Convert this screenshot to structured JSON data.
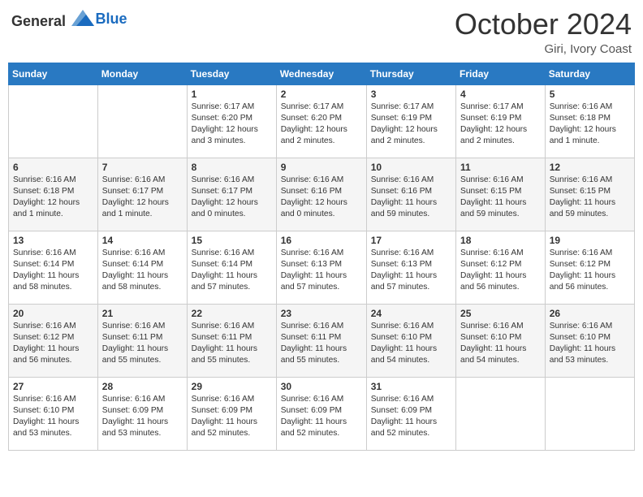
{
  "header": {
    "logo_general": "General",
    "logo_blue": "Blue",
    "month": "October 2024",
    "location": "Giri, Ivory Coast"
  },
  "weekdays": [
    "Sunday",
    "Monday",
    "Tuesday",
    "Wednesday",
    "Thursday",
    "Friday",
    "Saturday"
  ],
  "weeks": [
    [
      null,
      null,
      {
        "day": "1",
        "sunrise": "Sunrise: 6:17 AM",
        "sunset": "Sunset: 6:20 PM",
        "daylight": "Daylight: 12 hours and 3 minutes."
      },
      {
        "day": "2",
        "sunrise": "Sunrise: 6:17 AM",
        "sunset": "Sunset: 6:20 PM",
        "daylight": "Daylight: 12 hours and 2 minutes."
      },
      {
        "day": "3",
        "sunrise": "Sunrise: 6:17 AM",
        "sunset": "Sunset: 6:19 PM",
        "daylight": "Daylight: 12 hours and 2 minutes."
      },
      {
        "day": "4",
        "sunrise": "Sunrise: 6:17 AM",
        "sunset": "Sunset: 6:19 PM",
        "daylight": "Daylight: 12 hours and 2 minutes."
      },
      {
        "day": "5",
        "sunrise": "Sunrise: 6:16 AM",
        "sunset": "Sunset: 6:18 PM",
        "daylight": "Daylight: 12 hours and 1 minute."
      }
    ],
    [
      {
        "day": "6",
        "sunrise": "Sunrise: 6:16 AM",
        "sunset": "Sunset: 6:18 PM",
        "daylight": "Daylight: 12 hours and 1 minute."
      },
      {
        "day": "7",
        "sunrise": "Sunrise: 6:16 AM",
        "sunset": "Sunset: 6:17 PM",
        "daylight": "Daylight: 12 hours and 1 minute."
      },
      {
        "day": "8",
        "sunrise": "Sunrise: 6:16 AM",
        "sunset": "Sunset: 6:17 PM",
        "daylight": "Daylight: 12 hours and 0 minutes."
      },
      {
        "day": "9",
        "sunrise": "Sunrise: 6:16 AM",
        "sunset": "Sunset: 6:16 PM",
        "daylight": "Daylight: 12 hours and 0 minutes."
      },
      {
        "day": "10",
        "sunrise": "Sunrise: 6:16 AM",
        "sunset": "Sunset: 6:16 PM",
        "daylight": "Daylight: 11 hours and 59 minutes."
      },
      {
        "day": "11",
        "sunrise": "Sunrise: 6:16 AM",
        "sunset": "Sunset: 6:15 PM",
        "daylight": "Daylight: 11 hours and 59 minutes."
      },
      {
        "day": "12",
        "sunrise": "Sunrise: 6:16 AM",
        "sunset": "Sunset: 6:15 PM",
        "daylight": "Daylight: 11 hours and 59 minutes."
      }
    ],
    [
      {
        "day": "13",
        "sunrise": "Sunrise: 6:16 AM",
        "sunset": "Sunset: 6:14 PM",
        "daylight": "Daylight: 11 hours and 58 minutes."
      },
      {
        "day": "14",
        "sunrise": "Sunrise: 6:16 AM",
        "sunset": "Sunset: 6:14 PM",
        "daylight": "Daylight: 11 hours and 58 minutes."
      },
      {
        "day": "15",
        "sunrise": "Sunrise: 6:16 AM",
        "sunset": "Sunset: 6:14 PM",
        "daylight": "Daylight: 11 hours and 57 minutes."
      },
      {
        "day": "16",
        "sunrise": "Sunrise: 6:16 AM",
        "sunset": "Sunset: 6:13 PM",
        "daylight": "Daylight: 11 hours and 57 minutes."
      },
      {
        "day": "17",
        "sunrise": "Sunrise: 6:16 AM",
        "sunset": "Sunset: 6:13 PM",
        "daylight": "Daylight: 11 hours and 57 minutes."
      },
      {
        "day": "18",
        "sunrise": "Sunrise: 6:16 AM",
        "sunset": "Sunset: 6:12 PM",
        "daylight": "Daylight: 11 hours and 56 minutes."
      },
      {
        "day": "19",
        "sunrise": "Sunrise: 6:16 AM",
        "sunset": "Sunset: 6:12 PM",
        "daylight": "Daylight: 11 hours and 56 minutes."
      }
    ],
    [
      {
        "day": "20",
        "sunrise": "Sunrise: 6:16 AM",
        "sunset": "Sunset: 6:12 PM",
        "daylight": "Daylight: 11 hours and 56 minutes."
      },
      {
        "day": "21",
        "sunrise": "Sunrise: 6:16 AM",
        "sunset": "Sunset: 6:11 PM",
        "daylight": "Daylight: 11 hours and 55 minutes."
      },
      {
        "day": "22",
        "sunrise": "Sunrise: 6:16 AM",
        "sunset": "Sunset: 6:11 PM",
        "daylight": "Daylight: 11 hours and 55 minutes."
      },
      {
        "day": "23",
        "sunrise": "Sunrise: 6:16 AM",
        "sunset": "Sunset: 6:11 PM",
        "daylight": "Daylight: 11 hours and 55 minutes."
      },
      {
        "day": "24",
        "sunrise": "Sunrise: 6:16 AM",
        "sunset": "Sunset: 6:10 PM",
        "daylight": "Daylight: 11 hours and 54 minutes."
      },
      {
        "day": "25",
        "sunrise": "Sunrise: 6:16 AM",
        "sunset": "Sunset: 6:10 PM",
        "daylight": "Daylight: 11 hours and 54 minutes."
      },
      {
        "day": "26",
        "sunrise": "Sunrise: 6:16 AM",
        "sunset": "Sunset: 6:10 PM",
        "daylight": "Daylight: 11 hours and 53 minutes."
      }
    ],
    [
      {
        "day": "27",
        "sunrise": "Sunrise: 6:16 AM",
        "sunset": "Sunset: 6:10 PM",
        "daylight": "Daylight: 11 hours and 53 minutes."
      },
      {
        "day": "28",
        "sunrise": "Sunrise: 6:16 AM",
        "sunset": "Sunset: 6:09 PM",
        "daylight": "Daylight: 11 hours and 53 minutes."
      },
      {
        "day": "29",
        "sunrise": "Sunrise: 6:16 AM",
        "sunset": "Sunset: 6:09 PM",
        "daylight": "Daylight: 11 hours and 52 minutes."
      },
      {
        "day": "30",
        "sunrise": "Sunrise: 6:16 AM",
        "sunset": "Sunset: 6:09 PM",
        "daylight": "Daylight: 11 hours and 52 minutes."
      },
      {
        "day": "31",
        "sunrise": "Sunrise: 6:16 AM",
        "sunset": "Sunset: 6:09 PM",
        "daylight": "Daylight: 11 hours and 52 minutes."
      },
      null,
      null
    ]
  ]
}
